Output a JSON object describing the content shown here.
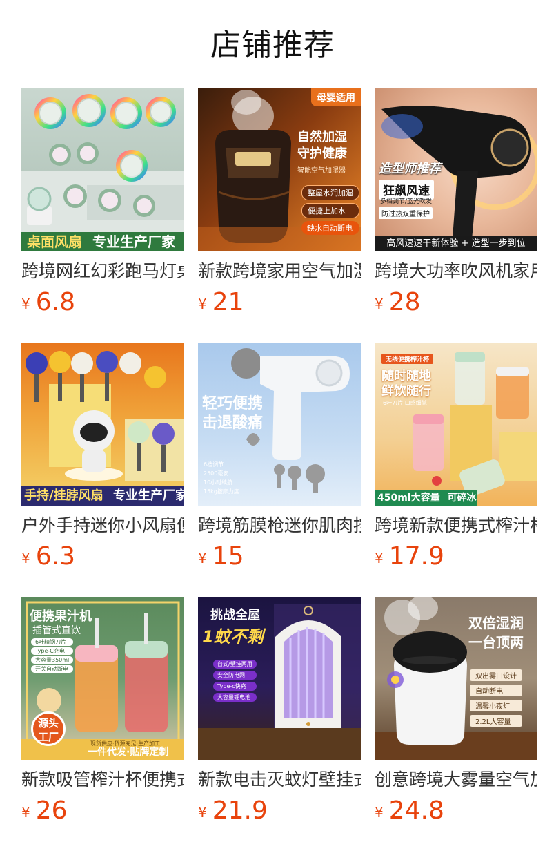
{
  "page": {
    "title": "店铺推荐"
  },
  "currency_symbol": "¥",
  "products": [
    {
      "name": "跨境网红幻彩跑马灯桌面风扇",
      "price": "6.8",
      "image": {
        "banner_left": "桌面风扇",
        "banner_right": "专业生产厂家"
      }
    },
    {
      "name": "新款跨境家用空气加湿器",
      "price": "21",
      "image": {
        "corner_tag": "母婴适用",
        "headline_1": "自然加湿",
        "headline_2": "守护健康",
        "sub": "智能空气加湿器",
        "chips": [
          "整屋水润加湿",
          "便捷上加水",
          "缺水自动断电"
        ]
      }
    },
    {
      "name": "跨境大功率吹风机家用",
      "price": "28",
      "image": {
        "script_title": "造型师推荐",
        "feature": "狂飙风速",
        "feature_sub": "多档调节/蓝光吹发",
        "protect": "防过热双重保护",
        "bottom": "高风速速干新体验 + 造型一步到位"
      }
    },
    {
      "name": "户外手持迷你小风扇便携",
      "price": "6.3",
      "image": {
        "banner_left": "手持/挂脖风扇",
        "banner_right": "专业生产厂家"
      }
    },
    {
      "name": "跨境筋膜枪迷你肌肉按摩",
      "price": "15",
      "image": {
        "headline_1": "轻巧便携",
        "headline_2": "击退酸痛",
        "specs": [
          "6档调节",
          "2500毫安",
          "10小时续航",
          "15kg按摩力度"
        ]
      }
    },
    {
      "name": "跨境新款便携式榨汁杯",
      "price": "17.9",
      "image": {
        "tag": "无线便携榨汁杯",
        "headline_1": "随时随地",
        "headline_2": "鲜饮随行",
        "sub": "6叶刀片 口感细腻",
        "banner_left": "450ml大容量",
        "banner_right": "可碎冰"
      }
    },
    {
      "name": "新款吸管榨汁杯便携式",
      "price": "26",
      "image": {
        "headline_1": "便携果汁机",
        "headline_2": "插管式直饮",
        "chips": [
          "6叶精钢刀片",
          "Type-C充电",
          "大容量350ml",
          "开关自动断电"
        ],
        "seal_1": "源头",
        "seal_2": "工厂",
        "footer_small": "现货供应·货源充足·生产加工",
        "footer_big": "一件代发·贴牌定制"
      }
    },
    {
      "name": "新款电击灭蚊灯壁挂式",
      "price": "21.9",
      "image": {
        "headline_1": "挑战全屋",
        "headline_2": "1蚊不剩",
        "chips": [
          "台式/壁挂两用",
          "安全防电网",
          "Type-c快充",
          "大容量锂电池"
        ]
      }
    },
    {
      "name": "创意跨境大雾量空气加湿器",
      "price": "24.8",
      "image": {
        "headline_1": "双倍湿润",
        "headline_2": "一台顶两",
        "chips": [
          "双出雾口设计",
          "自动断电",
          "温馨小夜灯",
          "2.2L大容量"
        ]
      }
    }
  ],
  "colors": {
    "price": "#e8430c",
    "title": "#111111",
    "name": "#333333"
  }
}
